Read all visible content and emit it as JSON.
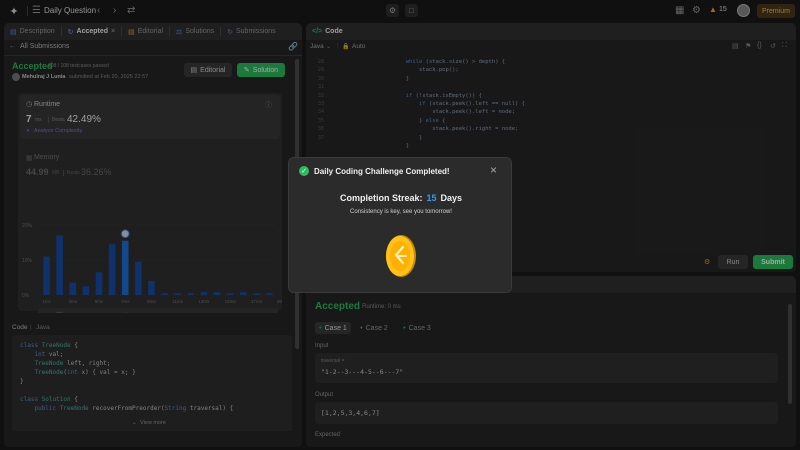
{
  "topbar": {
    "problem_list_label": "Daily Question",
    "streak_count": "15",
    "premium_label": "Premium"
  },
  "left_tabs": [
    {
      "label": "Description",
      "icon": "description-icon"
    },
    {
      "label": "Accepted",
      "icon": "accepted-icon"
    },
    {
      "label": "Editorial",
      "icon": "editorial-icon"
    },
    {
      "label": "Solutions",
      "icon": "solutions-icon"
    },
    {
      "label": "Submissions",
      "icon": "submissions-icon"
    }
  ],
  "submission": {
    "back_label": "All Submissions",
    "status": "Accepted",
    "testcases": "108 / 108 testcases passed",
    "user": "Mehulraj J Lunia",
    "submitted_at": "submitted at Feb 20, 2025 22:57",
    "editorial_btn": "Editorial",
    "solution_btn": "Solution"
  },
  "runtime": {
    "label": "Runtime",
    "value": "7",
    "unit": "ms",
    "beats_label": "Beats",
    "beats_value": "42.49%",
    "analyze_label": "Analyze Complexity"
  },
  "memory": {
    "label": "Memory",
    "value": "44.99",
    "unit": "MB",
    "beats_label": "Beats",
    "beats_value": "36.26%"
  },
  "chart_data": {
    "type": "bar",
    "y_ticks": [
      "20%",
      "10%",
      "0%"
    ],
    "ylim": [
      0,
      20
    ],
    "x_tick_labels": [
      "1ms",
      "3ms",
      "5ms",
      "7ms",
      "9ms",
      "11ms",
      "13ms",
      "15ms",
      "17ms",
      "20ms"
    ],
    "values": [
      11,
      17,
      3.5,
      2.5,
      6.5,
      14.5,
      15.5,
      9.5,
      4,
      0.5,
      0.5,
      0.5,
      0.8,
      0.8,
      0.5,
      0.8,
      0.5,
      0.5
    ],
    "highlight_index": 6,
    "mini_labels": [
      "0ms",
      "10ms",
      "19ms"
    ]
  },
  "code_header": {
    "label": "Code",
    "lang": "Java"
  },
  "code_snippet": [
    "class TreeNode {",
    "    int val;",
    "    TreeNode left, right;",
    "    TreeNode(int x) { val = x; }",
    "}",
    "",
    "class Solution {",
    "    public TreeNode recoverFromPreorder(String traversal) {"
  ],
  "view_more_label": "View more",
  "editor": {
    "tab_label": "Code",
    "lang": "Java",
    "mode": "Auto",
    "line_numbers": [
      "28",
      "29",
      "30",
      "31",
      "32",
      "33",
      "34",
      "35",
      "36",
      "37"
    ],
    "lines": [
      "            while (stack.size() > depth) {",
      "                stack.pop();",
      "            }",
      "",
      "            if (!stack.isEmpty()) {",
      "                if (stack.peek().left == null) {",
      "                    stack.peek().left = node;",
      "                } else {",
      "                    stack.peek().right = node;",
      "                }",
      "            }"
    ],
    "run_label": "Run",
    "submit_label": "Submit"
  },
  "result": {
    "status": "Accepted",
    "runtime": "Runtime: 0 ms",
    "cases": [
      "Case 1",
      "Case 2",
      "Case 3"
    ],
    "input_label": "Input",
    "var_name": "traversal =",
    "input_value": "\"1-2--3---4-5--6---7\"",
    "output_label": "Output",
    "output_value": "[1,2,5,3,4,6,7]",
    "expected_label": "Expected"
  },
  "modal": {
    "title": "Daily Coding Challenge Completed!",
    "streak_label": "Completion Streak:",
    "streak_value": "15",
    "streak_unit": "Days",
    "message": "Consistency is key, see you tomorrow!"
  },
  "colors": {
    "accent_green": "#2cbb5d",
    "bar_blue": "#1e6fd9",
    "bar_dark_blue": "#174ea6",
    "gold": "#ffb800"
  }
}
